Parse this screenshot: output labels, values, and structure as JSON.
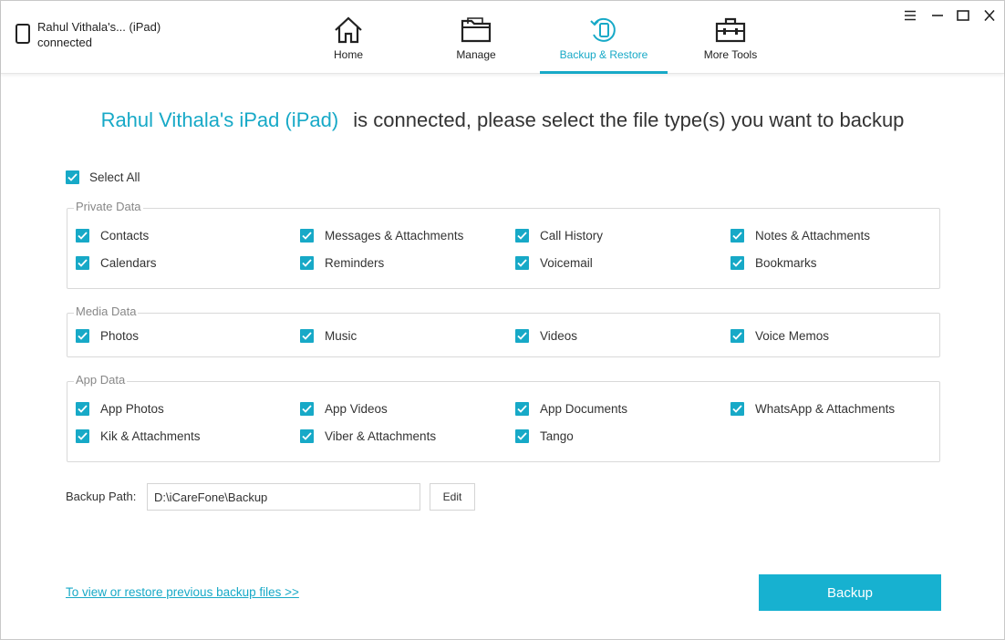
{
  "device": {
    "name": "Rahul Vithala's... (iPad)",
    "status": "connected"
  },
  "nav": {
    "home": "Home",
    "manage": "Manage",
    "backup_restore": "Backup & Restore",
    "more_tools": "More Tools",
    "active": "backup_restore"
  },
  "heading": {
    "device_name": "Rahul Vithala's iPad (iPad)",
    "text": "is connected, please select the file type(s) you want to backup"
  },
  "select_all": {
    "label": "Select All",
    "checked": true
  },
  "groups": {
    "private": {
      "title": "Private Data",
      "items": [
        "Contacts",
        "Messages & Attachments",
        "Call History",
        "Notes & Attachments",
        "Calendars",
        "Reminders",
        "Voicemail",
        "Bookmarks"
      ]
    },
    "media": {
      "title": "Media Data",
      "items": [
        "Photos",
        "Music",
        "Videos",
        "Voice Memos"
      ]
    },
    "app": {
      "title": "App Data",
      "items": [
        "App Photos",
        "App Videos",
        "App Documents",
        "WhatsApp & Attachments",
        "Kik & Attachments",
        "Viber & Attachments",
        "Tango"
      ]
    }
  },
  "backup_path": {
    "label": "Backup Path:",
    "value": "D:\\iCareFone\\Backup",
    "edit_label": "Edit"
  },
  "restore_link": "To view or restore previous backup files >>",
  "backup_button": "Backup",
  "colors": {
    "accent": "#17a9c7",
    "button": "#17b1d0"
  }
}
